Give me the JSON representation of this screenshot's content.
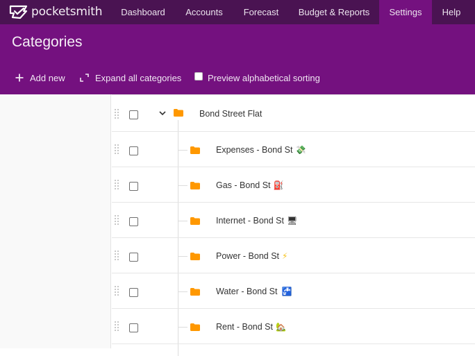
{
  "app": {
    "logo_text": "pocketsmith"
  },
  "nav": {
    "items": [
      {
        "label": "Dashboard",
        "active": false
      },
      {
        "label": "Accounts",
        "active": false
      },
      {
        "label": "Forecast",
        "active": false
      },
      {
        "label": "Budget & Reports",
        "active": false
      },
      {
        "label": "Settings",
        "active": true
      },
      {
        "label": "Help",
        "active": false
      }
    ]
  },
  "header": {
    "title": "Categories",
    "toolbar": {
      "add_new": "Add new",
      "expand_all": "Expand all categories",
      "preview_sorting": "Preview alphabetical sorting",
      "preview_sorting_checked": false
    }
  },
  "categories": {
    "parent": {
      "label": "Bond Street Flat",
      "expanded": true,
      "checked": false
    },
    "children": [
      {
        "label": "Expenses - Bond St",
        "emoji": "💸",
        "emoji_name": "money-with-wings-icon",
        "checked": false
      },
      {
        "label": "Gas - Bond St",
        "emoji": "⛽",
        "emoji_name": "fuel-pump-icon",
        "checked": false
      },
      {
        "label": "Internet - Bond St",
        "emoji": "🖥",
        "emoji_name": "desktop-computer-icon",
        "checked": false
      },
      {
        "label": "Power - Bond St",
        "emoji": "⚡",
        "emoji_name": "high-voltage-icon",
        "checked": false
      },
      {
        "label": "Water - Bond St",
        "emoji": "🚰",
        "emoji_name": "water-tap-icon",
        "checked": false
      },
      {
        "label": "Rent - Bond St",
        "emoji": "🏡",
        "emoji_name": "house-with-garden-icon",
        "checked": false
      }
    ]
  },
  "colors": {
    "nav_bg": "#4a1352",
    "brand_purple": "#74117f",
    "folder_orange": "#ff9800"
  }
}
